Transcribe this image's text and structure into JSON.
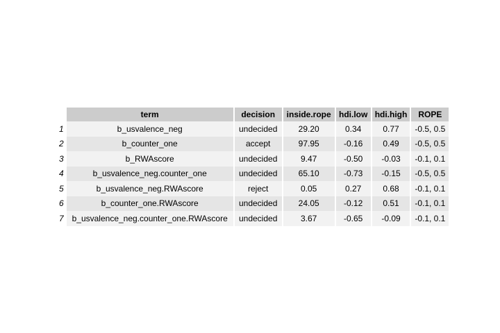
{
  "table": {
    "headers": [
      "term",
      "decision",
      "inside.rope",
      "hdi.low",
      "hdi.high",
      "ROPE"
    ],
    "rows": [
      {
        "num": "1",
        "term": "b_usvalence_neg",
        "decision": "undecided",
        "inside_rope": "29.20",
        "hdi_low": "0.34",
        "hdi_high": "0.77",
        "rope": "-0.5, 0.5"
      },
      {
        "num": "2",
        "term": "b_counter_one",
        "decision": "accept",
        "inside_rope": "97.95",
        "hdi_low": "-0.16",
        "hdi_high": "0.49",
        "rope": "-0.5, 0.5"
      },
      {
        "num": "3",
        "term": "b_RWAscore",
        "decision": "undecided",
        "inside_rope": "9.47",
        "hdi_low": "-0.50",
        "hdi_high": "-0.03",
        "rope": "-0.1, 0.1"
      },
      {
        "num": "4",
        "term": "b_usvalence_neg.counter_one",
        "decision": "undecided",
        "inside_rope": "65.10",
        "hdi_low": "-0.73",
        "hdi_high": "-0.15",
        "rope": "-0.5, 0.5"
      },
      {
        "num": "5",
        "term": "b_usvalence_neg.RWAscore",
        "decision": "reject",
        "inside_rope": "0.05",
        "hdi_low": "0.27",
        "hdi_high": "0.68",
        "rope": "-0.1, 0.1"
      },
      {
        "num": "6",
        "term": "b_counter_one.RWAscore",
        "decision": "undecided",
        "inside_rope": "24.05",
        "hdi_low": "-0.12",
        "hdi_high": "0.51",
        "rope": "-0.1, 0.1"
      },
      {
        "num": "7",
        "term": "b_usvalence_neg.counter_one.RWAscore",
        "decision": "undecided",
        "inside_rope": "3.67",
        "hdi_low": "-0.65",
        "hdi_high": "-0.09",
        "rope": "-0.1, 0.1"
      }
    ]
  }
}
